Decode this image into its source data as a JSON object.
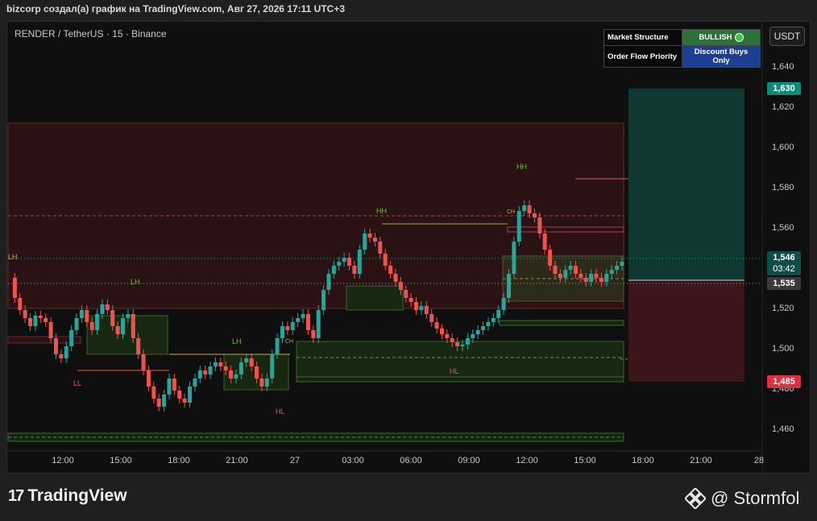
{
  "header": {
    "caption": "bizcorp создал(а) график на TradingView.com, Авг 27, 2026 17:11 UTC+3"
  },
  "chart": {
    "symbol_line": "RENDER / TetherUS · 15 · Binance",
    "currency_button": "USDT",
    "price_ticks": [
      "1,640",
      "1,620",
      "1,600",
      "1,580",
      "1,560",
      "1,520",
      "1,500",
      "1,480",
      "1,460"
    ],
    "time_ticks": [
      "12:00",
      "15:00",
      "18:00",
      "21:00",
      "27",
      "03:00",
      "06:00",
      "09:00",
      "12:00",
      "15:00",
      "18:00",
      "21:00",
      "28"
    ],
    "tags": {
      "tp": "1,630",
      "current": "1,546",
      "countdown": "03:42",
      "entry": "1,535",
      "sl": "1,485"
    },
    "labels": {
      "hh1": "HH",
      "hh2": "HH",
      "lh1": "LH",
      "lh2": "LH",
      "ll": "LL",
      "hl1": "HL",
      "hl2": "HL",
      "ch": "CH",
      "ch2": "CH",
      "lh_left": "LH"
    }
  },
  "market_table": {
    "row1_label": "Market Structure",
    "row1_value": "BULLISH",
    "row2_label": "Order Flow Priority",
    "row2_value": "Discount Buys Only"
  },
  "colors": {
    "up": "#26a69a",
    "down": "#ef5350",
    "tp_zone": "#0e3b34",
    "sl_zone": "#3d1418"
  },
  "icons": {
    "tv_logo": "tradingview-logo-icon",
    "author_logo": "binance-logo-icon"
  },
  "footer": {
    "brand": "TradingView",
    "author": "@ Stormfol"
  },
  "chart_data": {
    "type": "candlestick",
    "title": "",
    "yrange": [
      1.45,
      1.65
    ],
    "current_price": 1.546,
    "take_profit": 1.63,
    "entry": 1.535,
    "stop_loss": 1.485,
    "swing_labels": [
      {
        "label": "LH",
        "price": 1.532
      },
      {
        "label": "LL",
        "price": 1.485
      },
      {
        "label": "LH",
        "price": 1.502
      },
      {
        "label": "HL",
        "price": 1.472
      },
      {
        "label": "HH",
        "price": 1.566
      },
      {
        "label": "HL",
        "price": 1.492
      },
      {
        "label": "HH",
        "price": 1.59
      }
    ]
  }
}
